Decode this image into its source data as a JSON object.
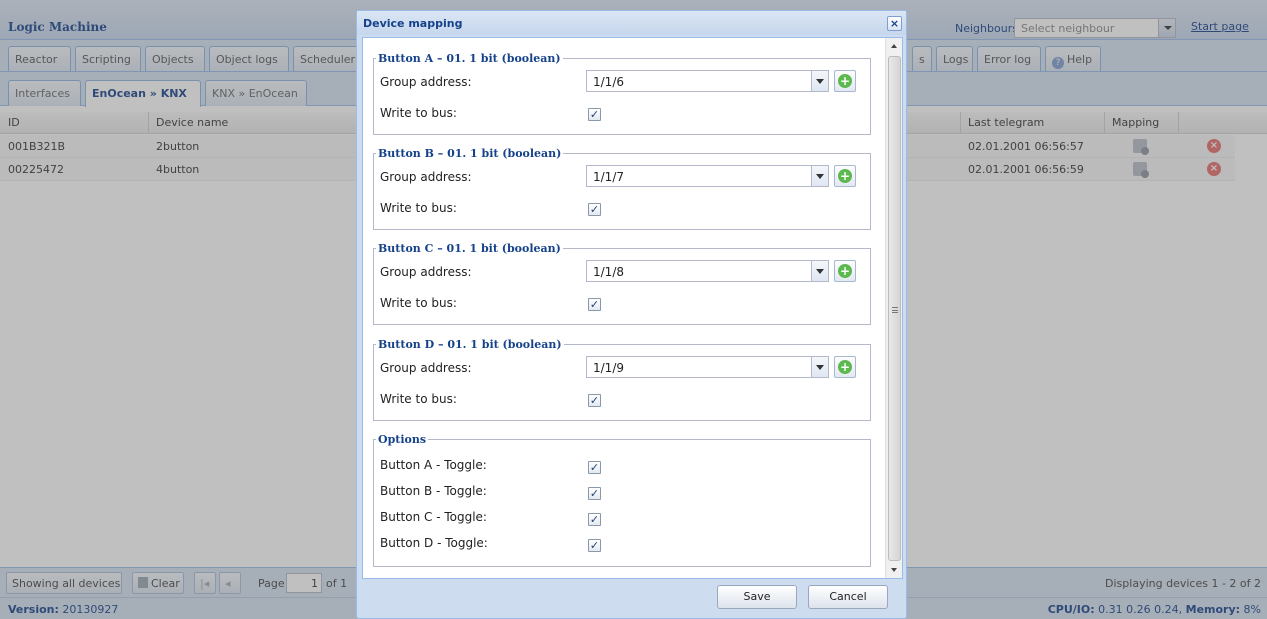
{
  "app": {
    "title": "Logic Machine",
    "neighbours_label": "Neighbours:",
    "neighbours_placeholder": "Select neighbour",
    "start_page": "Start page"
  },
  "main_tabs": [
    {
      "label": "Reactor"
    },
    {
      "label": "Scripting"
    },
    {
      "label": "Objects"
    },
    {
      "label": "Object logs"
    },
    {
      "label": "Scheduler"
    },
    {
      "label": "s"
    },
    {
      "label": "Logs"
    },
    {
      "label": "Error log"
    },
    {
      "label": "Help"
    }
  ],
  "sub_tabs": [
    {
      "label": "Interfaces"
    },
    {
      "label": "EnOcean » KNX"
    },
    {
      "label": "KNX » EnOcean"
    }
  ],
  "grid": {
    "columns": {
      "id": "ID",
      "device_name": "Device name",
      "last_telegram": "Last telegram",
      "mapping": "Mapping"
    },
    "rows": [
      {
        "id": "001B321B",
        "device_name": "2button",
        "last_telegram": "02.01.2001 06:56:57"
      },
      {
        "id": "00225472",
        "device_name": "4button",
        "last_telegram": "02.01.2001 06:56:59"
      }
    ]
  },
  "pager": {
    "showing": "Showing all devices",
    "clear": "Clear",
    "page_label": "Page",
    "page_value": "1",
    "of_label": "of 1",
    "status": "Displaying devices 1 - 2 of 2"
  },
  "footer": {
    "version_label": "Version:",
    "version": "20130927",
    "cpu_label": "CPU/IO:",
    "cpu": "0.31 0.26 0.24,",
    "memory_label": "Memory:",
    "memory": "8%"
  },
  "dialog": {
    "title": "Device mapping",
    "close": "×",
    "group_address_label": "Group address:",
    "write_to_bus_label": "Write to bus:",
    "buttons": [
      {
        "legend": "Button A – 01. 1 bit (boolean)",
        "group_address": "1/1/6",
        "write_to_bus": true
      },
      {
        "legend": "Button B – 01. 1 bit (boolean)",
        "group_address": "1/1/7",
        "write_to_bus": true
      },
      {
        "legend": "Button C – 01. 1 bit (boolean)",
        "group_address": "1/1/8",
        "write_to_bus": true
      },
      {
        "legend": "Button D – 01. 1 bit (boolean)",
        "group_address": "1/1/9",
        "write_to_bus": true
      }
    ],
    "options": {
      "legend": "Options",
      "items": [
        {
          "label": "Button A - Toggle:",
          "checked": true
        },
        {
          "label": "Button B - Toggle:",
          "checked": true
        },
        {
          "label": "Button C - Toggle:",
          "checked": true
        },
        {
          "label": "Button D - Toggle:",
          "checked": true
        }
      ]
    },
    "save": "Save",
    "cancel": "Cancel",
    "check_glyph": "✓"
  }
}
